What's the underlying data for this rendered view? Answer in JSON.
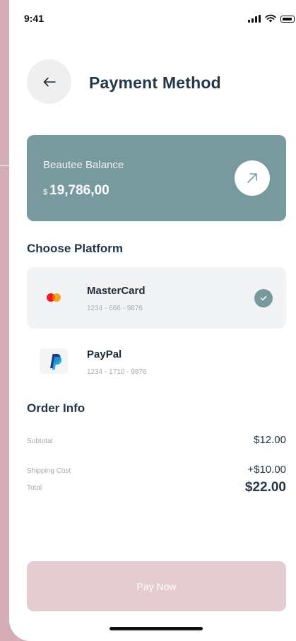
{
  "status_bar": {
    "time": "9:41"
  },
  "header": {
    "title": "Payment Method"
  },
  "balance": {
    "label": "Beautee Balance",
    "currency": "$",
    "amount": "19,786,00"
  },
  "platforms": {
    "title": "Choose Platform",
    "items": [
      {
        "name": "MasterCard",
        "number": "1234 - 666 - 9876",
        "selected": true
      },
      {
        "name": "PayPal",
        "number": "1234 - 1710 - 9876",
        "selected": false
      }
    ]
  },
  "order": {
    "title": "Order Info",
    "rows": [
      {
        "label": "Subtotal",
        "value": "$12.00"
      },
      {
        "label": "Shipping Cost",
        "value": "+$10.00"
      },
      {
        "label": "Total",
        "value": "$22.00"
      }
    ]
  },
  "actions": {
    "pay_label": "Pay Now"
  },
  "colors": {
    "background": "#d4adb7",
    "accent": "#789a9f",
    "pay_button": "#e4ccd0",
    "title_text": "#22374a"
  }
}
